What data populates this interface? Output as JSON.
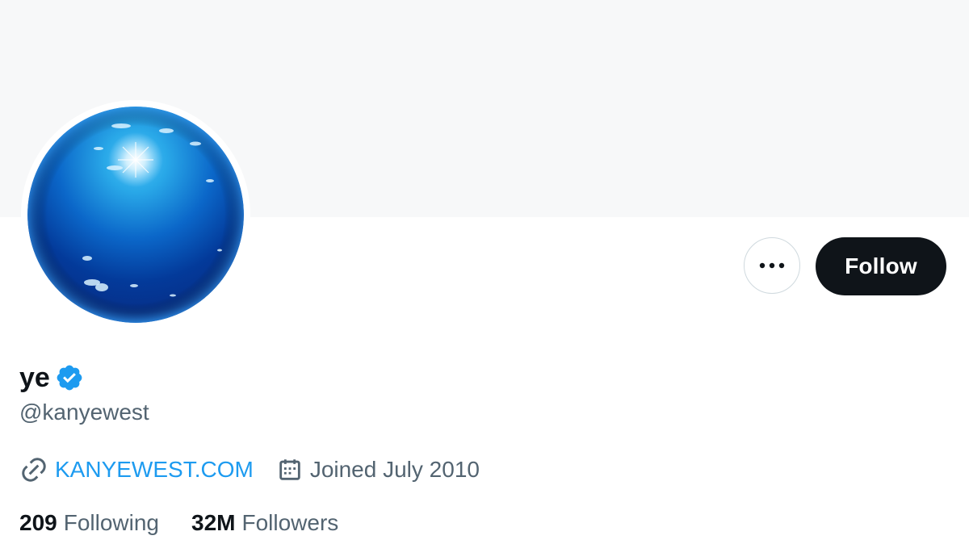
{
  "profile": {
    "display_name": "ye",
    "handle": "@kanyewest",
    "verified": true,
    "website": "KANYEWEST.COM",
    "joined": "Joined July 2010"
  },
  "stats": {
    "following_count": "209",
    "following_label": "Following",
    "followers_count": "32M",
    "followers_label": "Followers"
  },
  "actions": {
    "follow_label": "Follow",
    "more_icon": "more-horizontal-icon"
  },
  "colors": {
    "accent": "#1d9bf0",
    "follow_bg": "#0f1419",
    "secondary_text": "#536471",
    "banner": "#f7f8f9"
  },
  "icons": {
    "verified": "verified-badge-icon",
    "link": "link-icon",
    "calendar": "calendar-icon"
  }
}
